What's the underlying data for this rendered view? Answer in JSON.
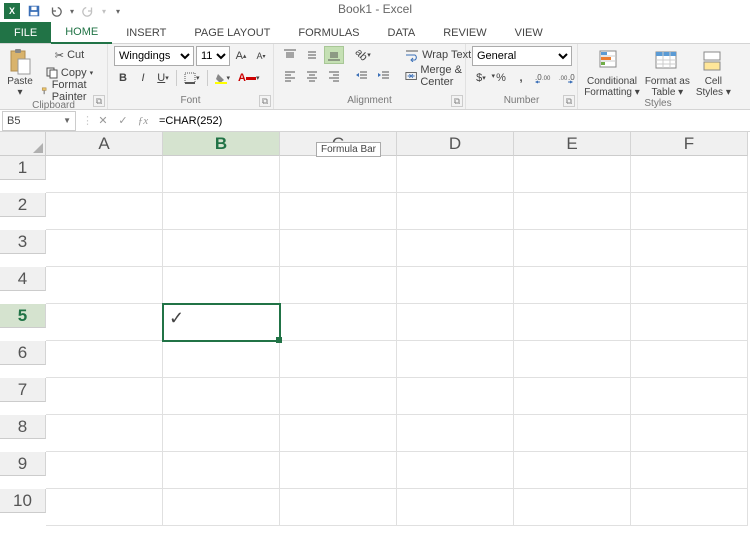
{
  "title": "Book1 - Excel",
  "tabs": {
    "file": "FILE",
    "home": "HOME",
    "insert": "INSERT",
    "layout": "PAGE LAYOUT",
    "formulas": "FORMULAS",
    "data": "DATA",
    "review": "REVIEW",
    "view": "VIEW"
  },
  "clipboard": {
    "paste": "Paste",
    "cut": "Cut",
    "copy": "Copy",
    "painter": "Format Painter",
    "group": "Clipboard"
  },
  "font": {
    "name": "Wingdings",
    "size": "11",
    "group": "Font"
  },
  "alignment": {
    "wrap": "Wrap Text",
    "merge": "Merge & Center",
    "group": "Alignment"
  },
  "number": {
    "format": "General",
    "group": "Number"
  },
  "styles": {
    "cond": "Conditional Formatting",
    "fat": "Format as Table",
    "cs": "Cell Styles",
    "group": "Styles"
  },
  "namebox": "B5",
  "formula": "=CHAR(252)",
  "tooltip": "Formula Bar",
  "columns": [
    "A",
    "B",
    "C",
    "D",
    "E",
    "F"
  ],
  "rows": [
    "1",
    "2",
    "3",
    "4",
    "5",
    "6",
    "7",
    "8",
    "9",
    "10"
  ],
  "active_cell": {
    "col": "B",
    "row": "5",
    "display": "✓"
  }
}
